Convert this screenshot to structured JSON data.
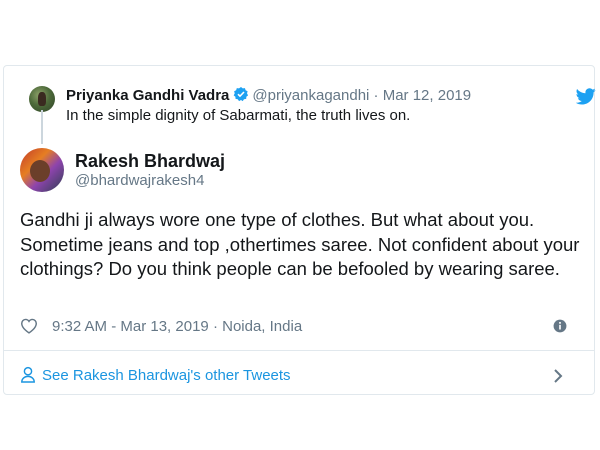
{
  "quoted_tweet": {
    "author_name": "Priyanka Gandhi Vadra",
    "handle": "@priyankagandhi",
    "separator": "·",
    "date": "Mar 12, 2019",
    "text": "In the simple dignity of Sabarmati, the truth lives on.",
    "verified": true
  },
  "tweet": {
    "author_name": "Rakesh Bhardwaj",
    "handle": "@bhardwajrakesh4",
    "text": "Gandhi ji always wore one type of clothes. But what about you. Sometime jeans and top ,othertimes saree. Not confident about your clothings? Do you think people can be befooled by wearing saree.",
    "time": "9:32 AM - Mar 13, 2019",
    "location_separator": "·",
    "location": "Noida, India"
  },
  "footer": {
    "see_more_label": "See Rakesh Bhardwaj's other Tweets"
  },
  "icons": {
    "brand": "twitter-bird-icon",
    "like": "heart-icon",
    "info": "info-icon",
    "verified": "verified-badge-icon",
    "person": "person-icon",
    "chevron": "chevron-right-icon"
  },
  "colors": {
    "twitter_blue": "#1da1f2",
    "link_blue": "#1b95e0",
    "muted": "#657786",
    "text": "#14171a",
    "border": "#e1e8ed"
  }
}
